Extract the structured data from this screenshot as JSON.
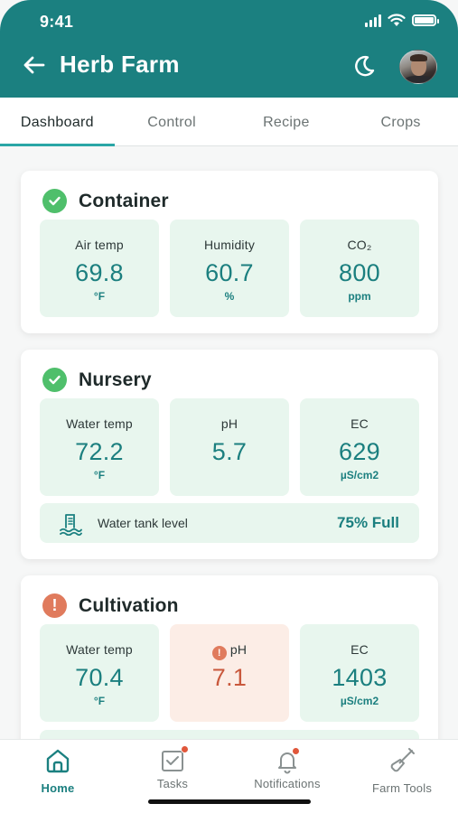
{
  "status_bar": {
    "time": "9:41"
  },
  "header": {
    "title": "Herb Farm",
    "back_icon": "arrow-left-icon",
    "theme_icon": "moon-icon"
  },
  "tabs": [
    {
      "label": "Dashboard",
      "active": true
    },
    {
      "label": "Control",
      "active": false
    },
    {
      "label": "Recipe",
      "active": false
    },
    {
      "label": "Crops",
      "active": false
    }
  ],
  "sections": {
    "container": {
      "title": "Container",
      "status": "ok",
      "metrics": [
        {
          "label": "Air temp",
          "value": "69.8",
          "unit": "°F"
        },
        {
          "label": "Humidity",
          "value": "60.7",
          "unit": "%"
        },
        {
          "label": "CO₂",
          "value": "800",
          "unit": "ppm"
        }
      ]
    },
    "nursery": {
      "title": "Nursery",
      "status": "ok",
      "metrics": [
        {
          "label": "Water temp",
          "value": "72.2",
          "unit": "°F"
        },
        {
          "label": "pH",
          "value": "5.7",
          "unit": ""
        },
        {
          "label": "EC",
          "value": "629",
          "unit": "µS/cm2"
        }
      ],
      "tank": {
        "label": "Water tank level",
        "value": "75% Full"
      }
    },
    "cultivation": {
      "title": "Cultivation",
      "status": "warning",
      "metrics": [
        {
          "label": "Water temp",
          "value": "70.4",
          "unit": "°F"
        },
        {
          "label": "pH",
          "value": "7.1",
          "unit": "",
          "alert": true
        },
        {
          "label": "EC",
          "value": "1403",
          "unit": "µS/cm2"
        }
      ]
    }
  },
  "bottom_nav": [
    {
      "label": "Home",
      "icon": "home-icon",
      "active": true
    },
    {
      "label": "Tasks",
      "icon": "tasks-icon",
      "badge": true
    },
    {
      "label": "Notifications",
      "icon": "bell-icon",
      "badge": true
    },
    {
      "label": "Farm Tools",
      "icon": "shovel-icon"
    }
  ],
  "colors": {
    "primary": "#1b8080",
    "accent": "#2aa6a6",
    "ok": "#4fbf6b",
    "warning": "#e07b5d",
    "tile": "#e8f6ee",
    "alert_tile": "#fcede6"
  }
}
